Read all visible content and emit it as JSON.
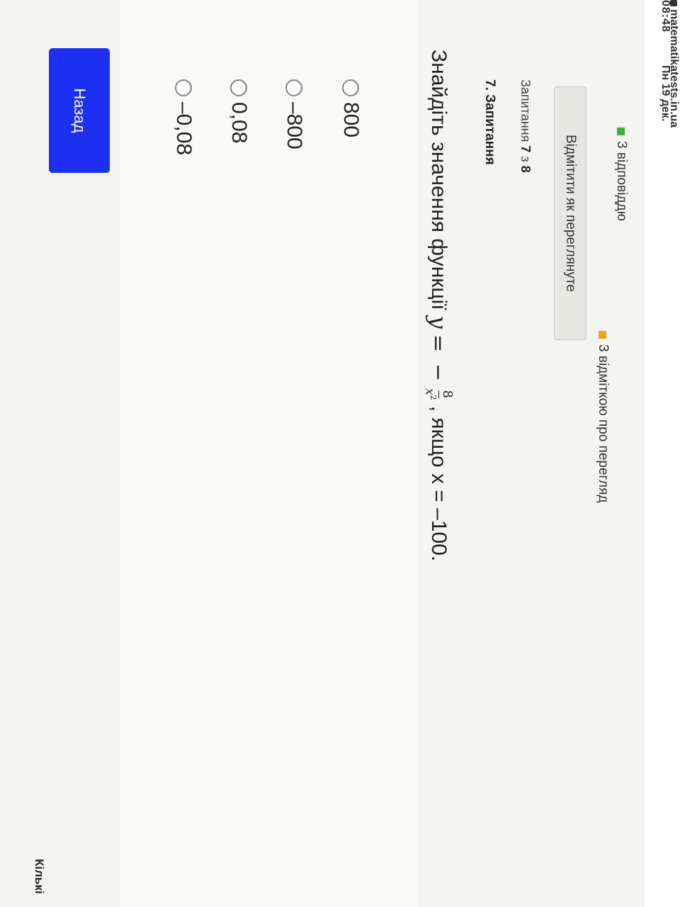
{
  "status_bar": {
    "time": "08:48",
    "date": "Пн 19 дек.",
    "url": "matematikatests.in.ua"
  },
  "legend": {
    "answered": "3 відповіддю",
    "marked": "3 відміткою про перегляд",
    "answered_color": "#3fae3a",
    "marked_color": "#f0a21d"
  },
  "mark_button_label": "Відмітити як переглянуте",
  "question_counter": {
    "prefix": "Запитання",
    "current": "7",
    "sep": "з",
    "total": "8"
  },
  "question_title": "7. Запитання",
  "question": {
    "text_before": "Знайдіть значення функції",
    "formula_lhs": "y",
    "formula_eq": "=",
    "formula_minus": "−",
    "frac_num": "8",
    "frac_den": "x",
    "frac_den_exp": "2",
    "text_after": ", якщо х = –100."
  },
  "answers": [
    {
      "label": "800"
    },
    {
      "label": "–800"
    },
    {
      "label": "0,08"
    },
    {
      "label": "–0,08"
    }
  ],
  "back_button_label": "Назад",
  "cutoff_label": "Кількі",
  "colors": {
    "back_button": "#1d2ff0"
  }
}
